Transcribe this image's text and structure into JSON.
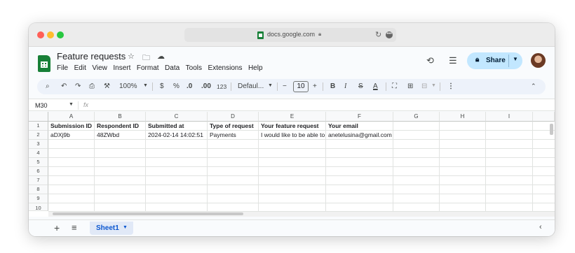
{
  "browser": {
    "url": "docs.google.com"
  },
  "doc": {
    "title": "Feature requests",
    "menu": [
      "File",
      "Edit",
      "View",
      "Insert",
      "Format",
      "Data",
      "Tools",
      "Extensions",
      "Help"
    ],
    "share_label": "Share"
  },
  "toolbar": {
    "zoom": "100%",
    "currency": "$",
    "percent": "%",
    "dec_decrease": ".0",
    "dec_increase": ".00",
    "number_format": "123",
    "font": "Defaul...",
    "font_size": "10",
    "minus": "−",
    "plus": "+",
    "bold": "B",
    "italic": "I",
    "strike": "S",
    "text_color": "A"
  },
  "formula_bar": {
    "cell_ref": "M30",
    "fx": "fx",
    "value": ""
  },
  "sheet": {
    "columns": [
      "A",
      "B",
      "C",
      "D",
      "E",
      "F",
      "G",
      "H",
      "I"
    ],
    "row_numbers": [
      "1",
      "2",
      "3",
      "4",
      "5",
      "6",
      "7",
      "8",
      "9",
      "10"
    ],
    "header_row": [
      "Submission ID",
      "Respondent ID",
      "Submitted at",
      "Type of request",
      "Your feature request",
      "Your email"
    ],
    "data_row": [
      "aDXj9b",
      "48ZWbd",
      "2024-02-14 14:02:51",
      "Payments",
      "I would like to be able to",
      "anetelusina@gmail.com"
    ]
  },
  "tabs": {
    "active": "Sheet1"
  },
  "colors": {
    "sheets_green": "#188038",
    "share_bg": "#c2e7ff",
    "toolbar_bg": "#edf2fa",
    "active_tab_text": "#0b57d0",
    "active_tab_bg": "#e1e9f7"
  }
}
